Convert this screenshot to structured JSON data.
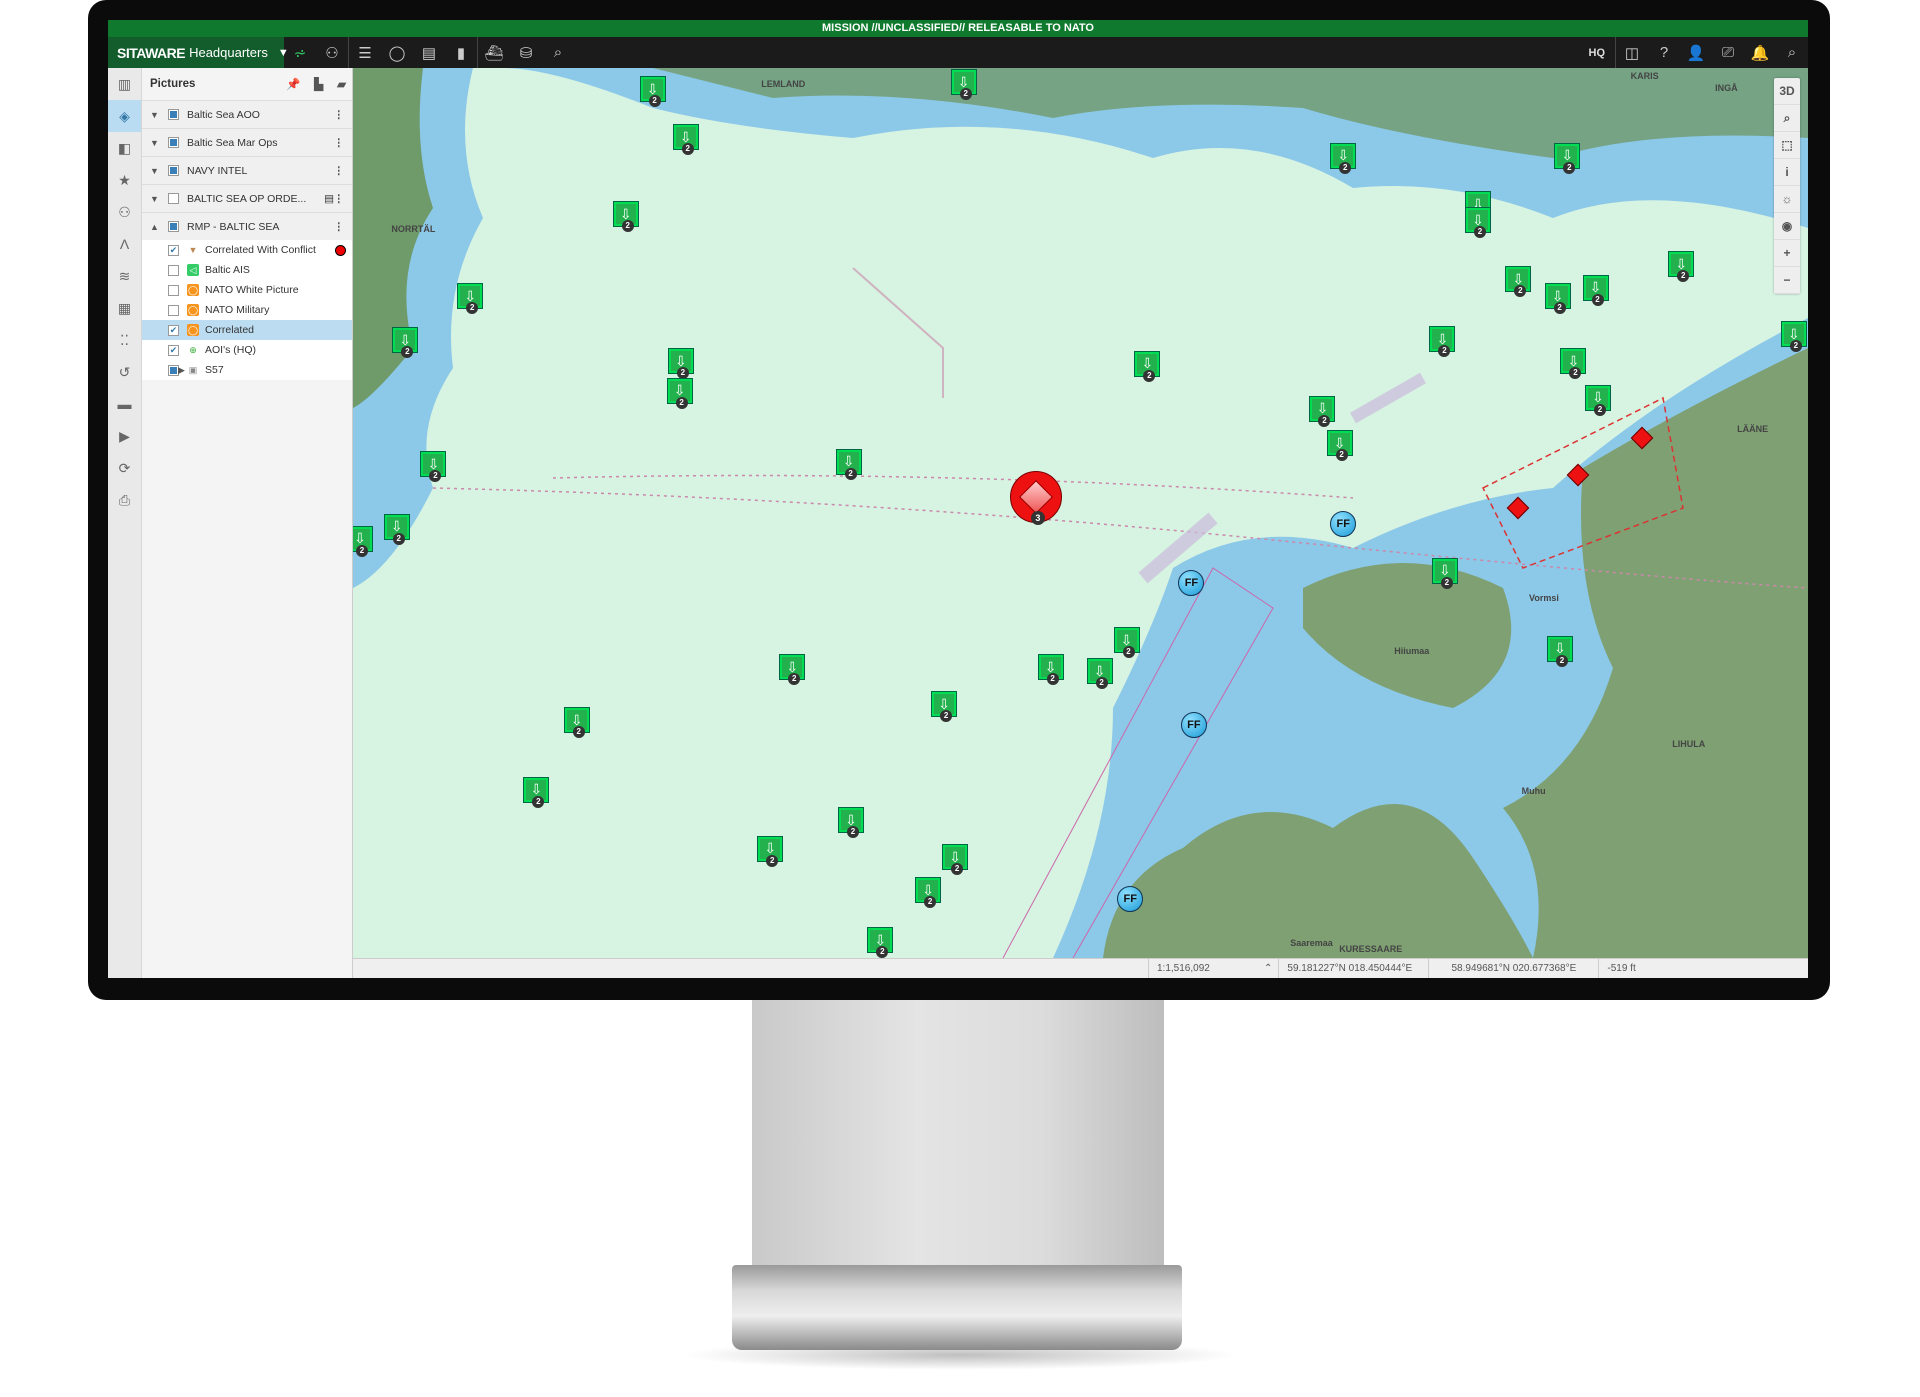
{
  "mission_banner": "MISSION //UNCLASSIFIED// RELEASABLE TO NATO",
  "app": {
    "brand": "SITAWARE",
    "product": "Headquarters",
    "hq_label": "HQ"
  },
  "toolbar_icons": [
    "map-icon",
    "hierarchy-icon",
    "list-icon",
    "chat-icon",
    "document-icon",
    "panel-icon",
    "ship-icon",
    "database-search-icon",
    "search-icon"
  ],
  "toolbar_right_icons": [
    "split-view-icon",
    "help-icon",
    "user-icon",
    "presentation-icon",
    "bell-icon",
    "search-icon"
  ],
  "colors": {
    "mission_bar": "#0f7a2e",
    "brand": "#135c2c",
    "friendly": "#22b14c",
    "hostile": "#e11111",
    "assumed_friend": "#1a9bd6",
    "alert_bell": "#f2b400"
  },
  "rail_icons": [
    "library-icon",
    "layers-icon",
    "shapes-icon",
    "star-icon",
    "org-chart-icon",
    "route-icon",
    "stack-icon",
    "overlay-icon",
    "footsteps-icon",
    "history-icon",
    "film-icon",
    "video-icon",
    "replay-icon",
    "print-icon"
  ],
  "panel": {
    "title": "Pictures",
    "groups": [
      {
        "label": "Baltic Sea AOO",
        "checked": "partial",
        "expanded": false
      },
      {
        "label": "Baltic Sea Mar Ops",
        "checked": "partial",
        "expanded": false
      },
      {
        "label": "NAVY INTEL",
        "checked": "partial",
        "expanded": false
      },
      {
        "label": "BALTIC SEA OP ORDE...",
        "checked": false,
        "expanded": false
      },
      {
        "label": "RMP - BALTIC SEA",
        "checked": "partial",
        "expanded": true
      }
    ],
    "items": [
      {
        "label": "Correlated With Conflict",
        "checked": true,
        "icon": "filter-icon"
      },
      {
        "label": "Baltic AIS",
        "checked": false,
        "icon": "ais-icon"
      },
      {
        "label": "NATO White Picture",
        "checked": false,
        "icon": "circle-icon"
      },
      {
        "label": "NATO Military",
        "checked": false,
        "icon": "circle-icon"
      },
      {
        "label": "Correlated",
        "checked": true,
        "icon": "circle-icon",
        "selected": true
      },
      {
        "label": "AOI's (HQ)",
        "checked": true,
        "icon": "globe-icon"
      },
      {
        "label": "S57",
        "checked": "partial",
        "icon": "folder-icon"
      }
    ]
  },
  "map": {
    "controls": [
      "3D",
      "zoom-box-icon",
      "select-icon",
      "info-icon",
      "brightness-icon",
      "eye-icon",
      "+",
      "−"
    ],
    "places": [
      "LEMLAND",
      "KARIS",
      "INGÅ",
      "NORRTÄL",
      "KURESSAARE",
      "LIHULA",
      "Hiiumaa",
      "Muhu",
      "Saaremaa",
      "LÄÄNE",
      "Vormsi"
    ],
    "unit_count_label": "2",
    "hostile_cluster_count": "3",
    "assumed_friend_label": "FF"
  },
  "status": {
    "scale": "1:1,516,092",
    "coord1": "59.181227°N 018.450444°E",
    "coord2": "58.949681°N 020.677368°E",
    "altitude": "-519 ft"
  }
}
